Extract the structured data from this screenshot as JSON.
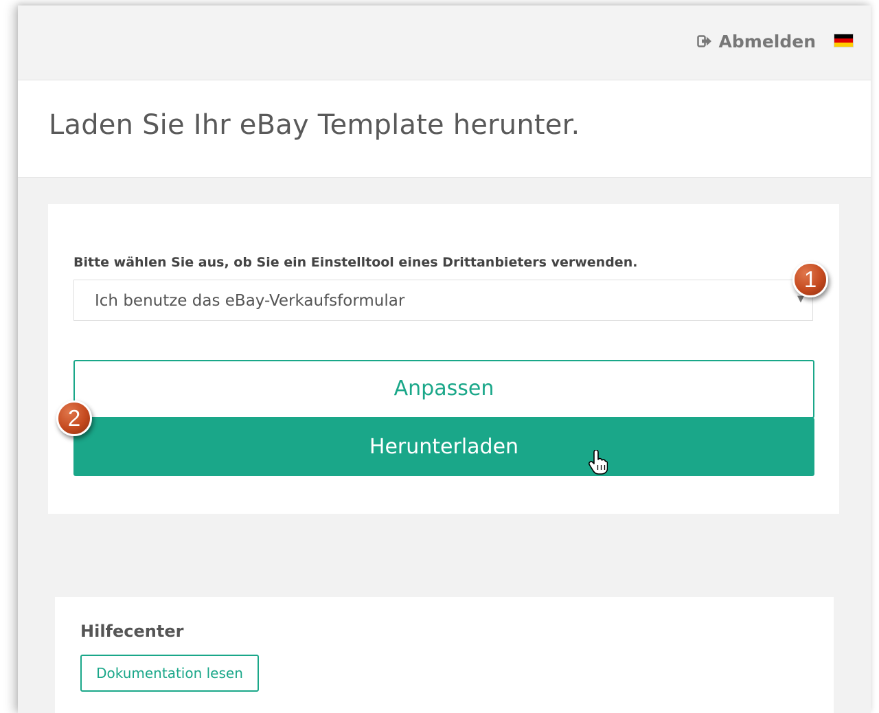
{
  "topbar": {
    "logout_label": "Abmelden",
    "logout_icon": "sign-out-icon",
    "language_flag": "germany-flag-icon",
    "flag_colors": [
      "#000000",
      "#dd0000",
      "#ffce00"
    ]
  },
  "header": {
    "title": "Laden Sie Ihr eBay Template herunter."
  },
  "form": {
    "select_label": "Bitte wählen Sie aus, ob Sie ein Einstelltool eines Drittanbieters verwenden.",
    "select_value": "Ich benutze das eBay-Verkaufsformular",
    "customize_label": "Anpassen",
    "download_label": "Herunterladen"
  },
  "help": {
    "title": "Hilfecenter",
    "docs_label": "Dokumentation lesen"
  },
  "annotations": {
    "marker_1": "1",
    "marker_2": "2"
  },
  "colors": {
    "accent": "#1aa789",
    "marker": "#c54a1f"
  }
}
